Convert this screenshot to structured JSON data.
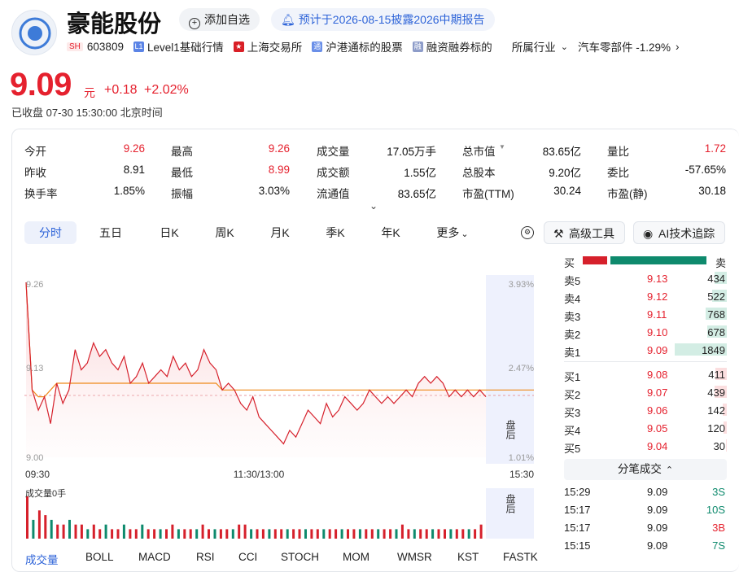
{
  "header": {
    "name": "豪能股份",
    "add_watch": "添加自选",
    "report_notice": "预计于2026-08-15披露2026中期报告",
    "market": "SH",
    "code": "603809",
    "tags": [
      "Level1基础行情",
      "上海交易所",
      "沪港通标的股票",
      "融资融券标的"
    ],
    "industry_label": "所属行业",
    "industry": "汽车零部件 -1.29%"
  },
  "quote": {
    "price": "9.09",
    "unit": "元",
    "change": "+0.18",
    "change_pct": "+2.02%",
    "status": "已收盘 07-30 15:30:00 北京时间"
  },
  "stats": [
    [
      {
        "l": "今开",
        "v": "9.26",
        "c": "red"
      },
      {
        "l": "最高",
        "v": "9.26",
        "c": "red"
      },
      {
        "l": "成交量",
        "v": "17.05万手",
        "c": "blk"
      },
      {
        "l": "总市值",
        "v": "83.65亿",
        "c": "blk"
      },
      {
        "l": "量比",
        "v": "1.72",
        "c": "red"
      }
    ],
    [
      {
        "l": "昨收",
        "v": "8.91",
        "c": "blk"
      },
      {
        "l": "最低",
        "v": "8.99",
        "c": "red"
      },
      {
        "l": "成交额",
        "v": "1.55亿",
        "c": "blk"
      },
      {
        "l": "总股本",
        "v": "9.20亿",
        "c": "blk"
      },
      {
        "l": "委比",
        "v": "-57.65%",
        "c": "blk"
      }
    ],
    [
      {
        "l": "换手率",
        "v": "1.85%",
        "c": "blk"
      },
      {
        "l": "振幅",
        "v": "3.03%",
        "c": "blk"
      },
      {
        "l": "流通值",
        "v": "83.65亿",
        "c": "blk"
      },
      {
        "l": "市盈(TTM)",
        "v": "30.24",
        "c": "blk"
      },
      {
        "l": "市盈(静)",
        "v": "30.18",
        "c": "blk"
      }
    ]
  ],
  "tabs": [
    "分时",
    "五日",
    "日K",
    "周K",
    "月K",
    "季K",
    "年K",
    "更多"
  ],
  "tools": {
    "advanced": "高级工具",
    "ai": "AI技术追踪"
  },
  "chart": {
    "y_high": "9.26",
    "y_mid": "9.13",
    "y_low": "9.00",
    "pct_high": "3.93%",
    "pct_mid": "2.47%",
    "pct_low": "1.01%",
    "x_start": "09:30",
    "x_mid": "11:30/13:00",
    "x_end": "15:30",
    "after_hours": "盘后",
    "volume_label": "成交量0手"
  },
  "chart_data": {
    "type": "line",
    "title": "",
    "series": [
      {
        "values": [
          9.26,
          9.1,
          9.07,
          9.09,
          9.05,
          9.11,
          9.08,
          9.1,
          9.16,
          9.13,
          9.14,
          9.17,
          9.15,
          9.16,
          9.14,
          9.13,
          9.15,
          9.11,
          9.12,
          9.14,
          9.11,
          9.12,
          9.13,
          9.12,
          9.15,
          9.13,
          9.14,
          9.12,
          9.13,
          9.16,
          9.14,
          9.13,
          9.1,
          9.11,
          9.1,
          9.08,
          9.07,
          9.09,
          9.06,
          9.05,
          9.04,
          9.03,
          9.02,
          9.04,
          9.03,
          9.05,
          9.07,
          9.06,
          9.05,
          9.08,
          9.06,
          9.07,
          9.09,
          9.08,
          9.07,
          9.08,
          9.1,
          9.09,
          9.08,
          9.09,
          9.08,
          9.09,
          9.1,
          9.09,
          9.11,
          9.12,
          9.11,
          9.12,
          9.11,
          9.09,
          9.1,
          9.09,
          9.1,
          9.09,
          9.1,
          9.09
        ]
      },
      {
        "values": [
          9.26,
          9.1,
          9.09,
          9.09,
          9.1,
          9.11,
          9.11,
          9.11,
          9.11,
          9.11,
          9.11,
          9.11,
          9.11,
          9.11,
          9.11,
          9.11,
          9.11,
          9.11,
          9.11,
          9.11,
          9.11,
          9.11,
          9.11,
          9.11,
          9.11,
          9.11,
          9.11,
          9.11,
          9.11,
          9.11,
          9.11,
          9.11,
          9.1,
          9.1,
          9.1,
          9.1,
          9.1,
          9.1,
          9.1,
          9.1,
          9.1,
          9.1,
          9.1,
          9.1,
          9.1,
          9.1,
          9.1,
          9.1,
          9.1,
          9.1,
          9.1,
          9.1,
          9.1,
          9.1,
          9.1,
          9.1,
          9.1,
          9.1,
          9.1,
          9.1,
          9.1,
          9.1,
          9.1,
          9.1,
          9.1,
          9.1,
          9.1,
          9.1,
          9.1,
          9.1,
          9.1,
          9.1,
          9.1,
          9.1,
          9.1,
          9.1
        ]
      }
    ],
    "ylim": [
      9.0,
      9.26
    ],
    "prev_close": 8.91,
    "volume": [
      9,
      4,
      6,
      5,
      4,
      3,
      3,
      4,
      3,
      3,
      2,
      3,
      2,
      3,
      2,
      2,
      3,
      2,
      2,
      3,
      2,
      2,
      2,
      2,
      3,
      2,
      2,
      2,
      2,
      3,
      2,
      2,
      2,
      2,
      2,
      3,
      3,
      2,
      2,
      2,
      2,
      2,
      2,
      2,
      2,
      2,
      2,
      2,
      2,
      2,
      2,
      2,
      2,
      2,
      2,
      2,
      2,
      2,
      2,
      2,
      2,
      2,
      3,
      2,
      2,
      2,
      2,
      2,
      2,
      2,
      2,
      2,
      2,
      2,
      2,
      3
    ]
  },
  "orderbook": {
    "buy_label": "买",
    "sell_label": "卖",
    "asks": [
      {
        "label": "卖5",
        "price": "9.13",
        "vol": "434",
        "pct": 0.23
      },
      {
        "label": "卖4",
        "price": "9.12",
        "vol": "522",
        "pct": 0.28
      },
      {
        "label": "卖3",
        "price": "9.11",
        "vol": "768",
        "pct": 0.41
      },
      {
        "label": "卖2",
        "price": "9.10",
        "vol": "678",
        "pct": 0.37
      },
      {
        "label": "卖1",
        "price": "9.09",
        "vol": "1849",
        "pct": 1.0
      }
    ],
    "bids": [
      {
        "label": "买1",
        "price": "9.08",
        "vol": "411",
        "pct": 0.22
      },
      {
        "label": "买2",
        "price": "9.07",
        "vol": "439",
        "pct": 0.24
      },
      {
        "label": "买3",
        "price": "9.06",
        "vol": "142",
        "pct": 0.08
      },
      {
        "label": "买4",
        "price": "9.05",
        "vol": "120",
        "pct": 0.07
      },
      {
        "label": "买5",
        "price": "9.04",
        "vol": "30",
        "pct": 0.02
      }
    ],
    "ticks_title": "分笔成交",
    "ticks": [
      {
        "t": "15:29",
        "p": "9.09",
        "v": "3S"
      },
      {
        "t": "15:17",
        "p": "9.09",
        "v": "10S"
      },
      {
        "t": "15:17",
        "p": "9.09",
        "v": "3B"
      },
      {
        "t": "15:15",
        "p": "9.09",
        "v": "7S"
      }
    ]
  },
  "indicators": [
    "成交量",
    "BOLL",
    "MACD",
    "RSI",
    "CCI",
    "STOCH",
    "MOM",
    "WMSR",
    "KST",
    "FASTK"
  ]
}
